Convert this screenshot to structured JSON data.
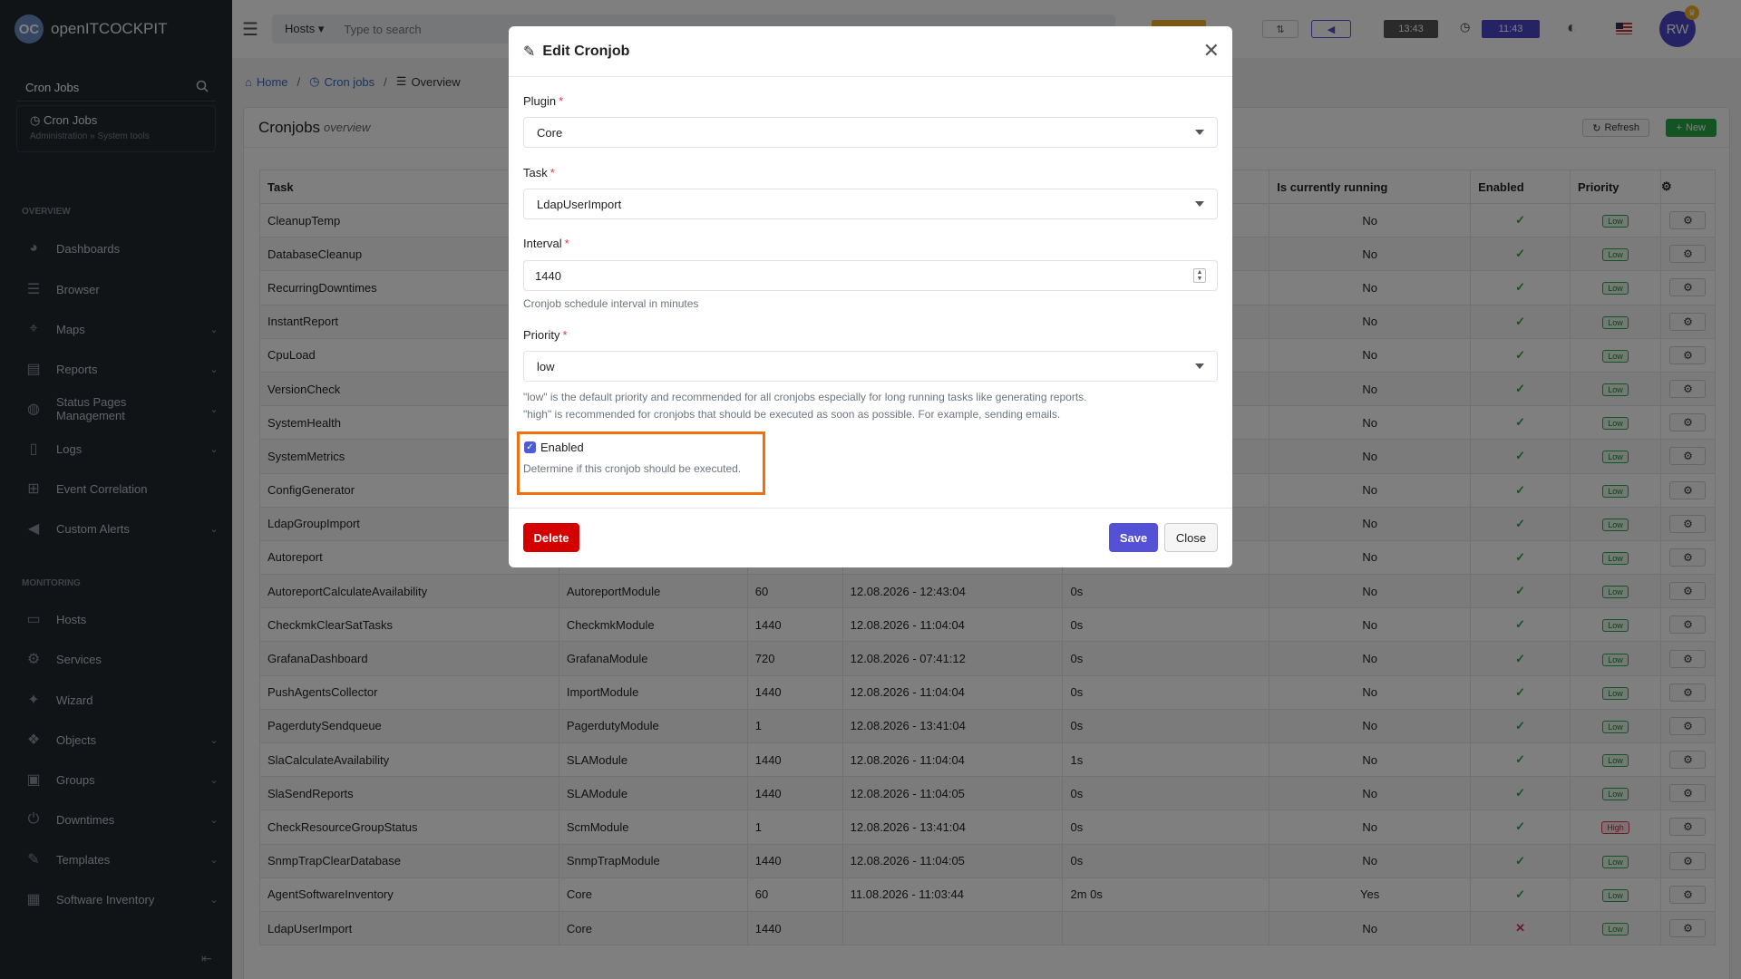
{
  "brand": {
    "logo_text": "OC",
    "name": "openITCOCKPIT"
  },
  "sidebar": {
    "search_value": "Cron Jobs",
    "result": {
      "title": "Cron Jobs",
      "path": "Administration » System tools"
    },
    "sections": {
      "overview": "OVERVIEW",
      "monitoring": "MONITORING"
    },
    "items": [
      {
        "label": "Dashboards",
        "icon": "palette-icon",
        "chev": false
      },
      {
        "label": "Browser",
        "icon": "list-icon",
        "chev": false
      },
      {
        "label": "Maps",
        "icon": "map-pin-icon",
        "chev": true
      },
      {
        "label": "Reports",
        "icon": "file-chart-icon",
        "chev": true
      },
      {
        "label": "Status Pages Management",
        "icon": "globe-icon",
        "chev": true
      },
      {
        "label": "Logs",
        "icon": "file-icon",
        "chev": true
      },
      {
        "label": "Event Correlation",
        "icon": "sitemap-icon",
        "chev": false
      },
      {
        "label": "Custom Alerts",
        "icon": "megaphone-icon",
        "chev": true
      },
      {
        "label": "Hosts",
        "icon": "desktop-icon",
        "chev": false
      },
      {
        "label": "Services",
        "icon": "cogs-icon",
        "chev": false
      },
      {
        "label": "Wizard",
        "icon": "magic-wand-icon",
        "chev": false
      },
      {
        "label": "Objects",
        "icon": "cubes-icon",
        "chev": true
      },
      {
        "label": "Groups",
        "icon": "object-group-icon",
        "chev": true
      },
      {
        "label": "Downtimes",
        "icon": "power-icon",
        "chev": true
      },
      {
        "label": "Templates",
        "icon": "edit-icon",
        "chev": true
      },
      {
        "label": "Software Inventory",
        "icon": "box-icon",
        "chev": true
      }
    ]
  },
  "topbar": {
    "search_scope": "Hosts",
    "search_placeholder": "Type to search",
    "clock_local": "13:43",
    "clock_server": "11:43",
    "avatar_initials": "RW"
  },
  "breadcrumb": {
    "home": "Home",
    "cron": "Cron jobs",
    "overview": "Overview"
  },
  "card": {
    "title": "Cronjobs",
    "subtitle": "overview",
    "refresh_label": "Refresh",
    "new_label": "New",
    "columns": {
      "task": "Task",
      "running": "Is currently running",
      "enabled": "Enabled",
      "priority": "Priority"
    },
    "rows": [
      {
        "task": "CleanupTemp",
        "plugin": "",
        "interval": "",
        "last": "",
        "duration": "",
        "running": "No",
        "enabled": true,
        "priority": "Low"
      },
      {
        "task": "DatabaseCleanup",
        "plugin": "",
        "interval": "",
        "last": "",
        "duration": "",
        "running": "No",
        "enabled": true,
        "priority": "Low"
      },
      {
        "task": "RecurringDowntimes",
        "plugin": "",
        "interval": "",
        "last": "",
        "duration": "",
        "running": "No",
        "enabled": true,
        "priority": "Low"
      },
      {
        "task": "InstantReport",
        "plugin": "",
        "interval": "",
        "last": "",
        "duration": "",
        "running": "No",
        "enabled": true,
        "priority": "Low"
      },
      {
        "task": "CpuLoad",
        "plugin": "",
        "interval": "",
        "last": "",
        "duration": "",
        "running": "No",
        "enabled": true,
        "priority": "Low"
      },
      {
        "task": "VersionCheck",
        "plugin": "",
        "interval": "",
        "last": "",
        "duration": "",
        "running": "No",
        "enabled": true,
        "priority": "Low"
      },
      {
        "task": "SystemHealth",
        "plugin": "",
        "interval": "",
        "last": "",
        "duration": "",
        "running": "No",
        "enabled": true,
        "priority": "Low"
      },
      {
        "task": "SystemMetrics",
        "plugin": "",
        "interval": "",
        "last": "",
        "duration": "",
        "running": "No",
        "enabled": true,
        "priority": "Low"
      },
      {
        "task": "ConfigGenerator",
        "plugin": "",
        "interval": "",
        "last": "",
        "duration": "",
        "running": "No",
        "enabled": true,
        "priority": "Low"
      },
      {
        "task": "LdapGroupImport",
        "plugin": "",
        "interval": "",
        "last": "",
        "duration": "",
        "running": "No",
        "enabled": true,
        "priority": "Low"
      },
      {
        "task": "Autoreport",
        "plugin": "",
        "interval": "",
        "last": "",
        "duration": "",
        "running": "No",
        "enabled": true,
        "priority": "Low"
      },
      {
        "task": "AutoreportCalculateAvailability",
        "plugin": "AutoreportModule",
        "interval": "60",
        "last": "12.08.2026 - 12:43:04",
        "duration": "0s",
        "running": "No",
        "enabled": true,
        "priority": "Low"
      },
      {
        "task": "CheckmkClearSatTasks",
        "plugin": "CheckmkModule",
        "interval": "1440",
        "last": "12.08.2026 - 11:04:04",
        "duration": "0s",
        "running": "No",
        "enabled": true,
        "priority": "Low"
      },
      {
        "task": "GrafanaDashboard",
        "plugin": "GrafanaModule",
        "interval": "720",
        "last": "12.08.2026 - 07:41:12",
        "duration": "0s",
        "running": "No",
        "enabled": true,
        "priority": "Low"
      },
      {
        "task": "PushAgentsCollector",
        "plugin": "ImportModule",
        "interval": "1440",
        "last": "12.08.2026 - 11:04:04",
        "duration": "0s",
        "running": "No",
        "enabled": true,
        "priority": "Low"
      },
      {
        "task": "PagerdutySendqueue",
        "plugin": "PagerdutyModule",
        "interval": "1",
        "last": "12.08.2026 - 13:41:04",
        "duration": "0s",
        "running": "No",
        "enabled": true,
        "priority": "Low"
      },
      {
        "task": "SlaCalculateAvailability",
        "plugin": "SLAModule",
        "interval": "1440",
        "last": "12.08.2026 - 11:04:04",
        "duration": "1s",
        "running": "No",
        "enabled": true,
        "priority": "Low"
      },
      {
        "task": "SlaSendReports",
        "plugin": "SLAModule",
        "interval": "1440",
        "last": "12.08.2026 - 11:04:05",
        "duration": "0s",
        "running": "No",
        "enabled": true,
        "priority": "Low"
      },
      {
        "task": "CheckResourceGroupStatus",
        "plugin": "ScmModule",
        "interval": "1",
        "last": "12.08.2026 - 13:41:04",
        "duration": "0s",
        "running": "No",
        "enabled": true,
        "priority": "High"
      },
      {
        "task": "SnmpTrapClearDatabase",
        "plugin": "SnmpTrapModule",
        "interval": "1440",
        "last": "12.08.2026 - 11:04:05",
        "duration": "0s",
        "running": "No",
        "enabled": true,
        "priority": "Low"
      },
      {
        "task": "AgentSoftwareInventory",
        "plugin": "Core",
        "interval": "60",
        "last": "11.08.2026 - 11:03:44",
        "duration": "2m 0s",
        "running": "Yes",
        "enabled": true,
        "priority": "Low"
      },
      {
        "task": "LdapUserImport",
        "plugin": "Core",
        "interval": "1440",
        "last": "",
        "duration": "",
        "running": "No",
        "enabled": false,
        "priority": "Low"
      }
    ]
  },
  "modal": {
    "title": "Edit Cronjob",
    "plugin_label": "Plugin",
    "plugin_value": "Core",
    "task_label": "Task",
    "task_value": "LdapUserImport",
    "interval_label": "Interval",
    "interval_value": "1440",
    "interval_help": "Cronjob schedule interval in minutes",
    "priority_label": "Priority",
    "priority_value": "low",
    "priority_help_1": "\"low\" is the default priority and recommended for all cronjobs especially for long running tasks like generating reports.",
    "priority_help_2": "\"high\" is recommended for cronjobs that should be executed as soon as possible. For example, sending emails.",
    "enabled_label": "Enabled",
    "enabled_checked": true,
    "enabled_help": "Determine if this cronjob should be executed.",
    "delete_label": "Delete",
    "save_label": "Save",
    "close_label": "Close",
    "required_mark": "*"
  },
  "colors": {
    "accent": "#5451d6",
    "danger": "#d40000",
    "success": "#28a745",
    "highlight": "#f0700e",
    "sidebar_bg": "#23282e"
  }
}
